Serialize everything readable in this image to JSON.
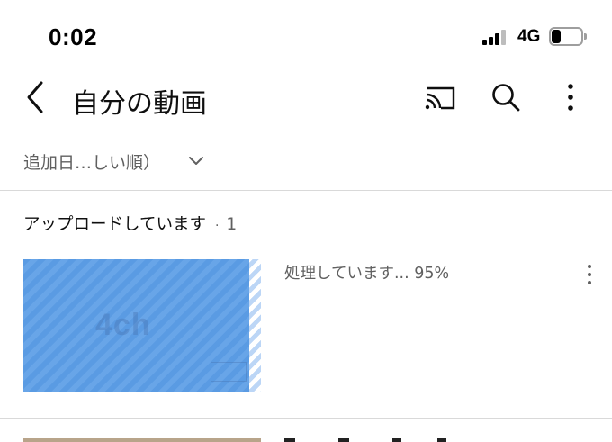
{
  "status_bar": {
    "time": "0:02",
    "network": "4G",
    "battery_level": 0.3
  },
  "app_bar": {
    "title": "自分の動画",
    "icons": [
      "back-arrow-icon",
      "cast-icon",
      "search-icon",
      "more-vert-icon"
    ]
  },
  "sort": {
    "label": "追加日…しい順）",
    "icon": "chevron-down-icon"
  },
  "uploading_section": {
    "title": "アップロードしています",
    "separator": "·",
    "count": "1",
    "item": {
      "status": "処理しています... 95%",
      "progress": 0.95,
      "thumbnail_watermark": "4ch",
      "colors": {
        "progress": "#5a9be3",
        "remaining": "#bcd6f6"
      }
    }
  },
  "colors": {
    "text_primary": "#0f0f0f",
    "text_secondary": "#606060",
    "divider": "#d9d9d9",
    "background": "#ffffff"
  }
}
